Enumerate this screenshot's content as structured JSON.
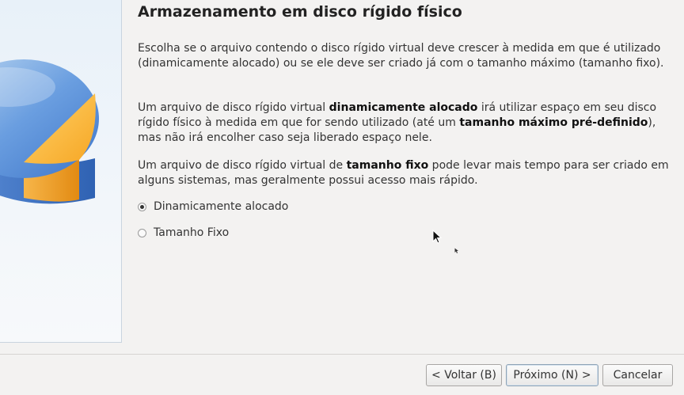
{
  "page": {
    "title": "Armazenamento em disco rígido físico"
  },
  "paragraphs": {
    "intro": "Escolha se o arquivo contendo o disco rígido virtual deve crescer à medida em que é utilizado (dinamicamente alocado) ou se ele deve ser criado já com o tamanho máximo (tamanho fixo).",
    "dynamic": {
      "part1": "Um arquivo de disco rígido virtual ",
      "bold1": "dinamicamente alocado",
      "part2": " irá utilizar espaço em seu disco rígido físico à medida em que for sendo utilizado (até um ",
      "bold2": "tamanho máximo pré-definido",
      "part3": "), mas não irá encolher caso seja liberado espaço nele."
    },
    "fixed": {
      "part1": "Um arquivo de disco rígido virtual de ",
      "bold1": "tamanho fixo",
      "part2": " pode levar mais tempo para ser criado em alguns sistemas, mas geralmente possui acesso mais rápido."
    }
  },
  "options": {
    "dynamic_label": "Dinamicamente alocado",
    "dynamic_checked": true,
    "fixed_label": "Tamanho Fixo",
    "fixed_checked": false
  },
  "buttons": {
    "back": "< Voltar (B)",
    "next": "Próximo (N) >",
    "cancel": "Cancelar"
  },
  "icons": {
    "side_graphic": "disk-pie-icon",
    "cursor": "mouse-pointer-icon"
  },
  "colors": {
    "pie_blue": "#3f76c9",
    "pie_orange": "#f3a52a",
    "panel_bg": "#e8f1f9"
  }
}
